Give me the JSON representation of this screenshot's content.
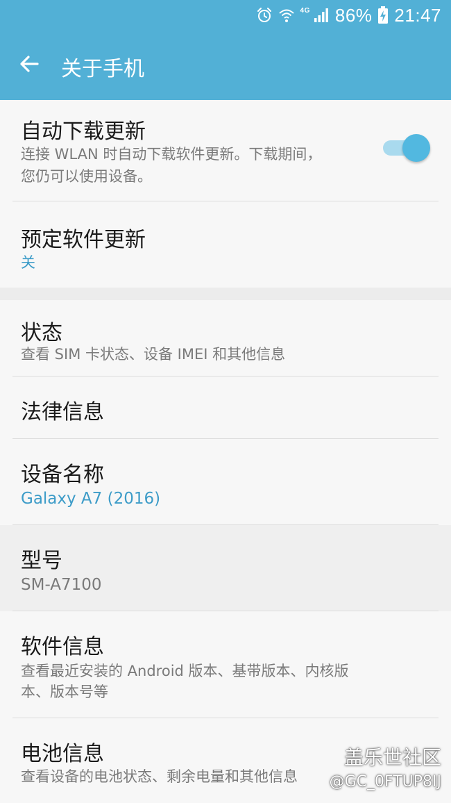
{
  "status_bar": {
    "network": "4G",
    "battery_percent": "86%",
    "time": "21:47",
    "icons": [
      "alarm-icon",
      "wifi-icon",
      "signal-icon",
      "battery-charging-icon"
    ]
  },
  "app_bar": {
    "back_icon": "arrow-left-icon",
    "title": "关于手机"
  },
  "items": {
    "auto_update": {
      "title": "自动下载更新",
      "subtitle_line1": "连接 WLAN 时自动下载软件更新。下载期间，",
      "subtitle_line2": "您仍可以使用设备。",
      "toggle_on": true
    },
    "scheduled_update": {
      "title": "预定软件更新",
      "value": "关"
    },
    "status": {
      "title": "状态",
      "subtitle": "查看 SIM 卡状态、设备 IMEI 和其他信息"
    },
    "legal": {
      "title": "法律信息"
    },
    "device_name": {
      "title": "设备名称",
      "value": "Galaxy A7 (2016)"
    },
    "model": {
      "title": "型号",
      "value": "SM-A7100"
    },
    "software_info": {
      "title": "软件信息",
      "subtitle_line1": "查看最近安装的 Android 版本、基带版本、内核版",
      "subtitle_line2": "本、版本号等"
    },
    "battery_info": {
      "title": "电池信息",
      "subtitle": "查看设备的电池状态、剩余电量和其他信息"
    }
  },
  "watermark": {
    "line1": "盖乐世社区",
    "line2": "@GC_0FTUP8IJ"
  },
  "colors": {
    "header": "#52b0d6",
    "accent": "#3d9cc8",
    "toggle_thumb": "#52b8e0"
  }
}
